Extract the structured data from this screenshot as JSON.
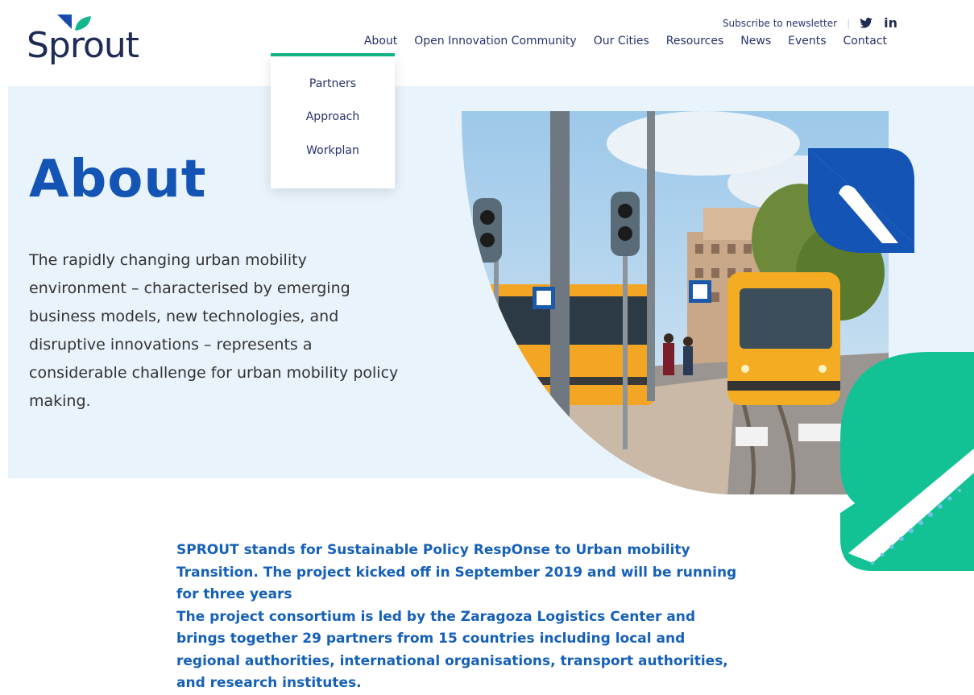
{
  "brand": {
    "name": "Sprout",
    "color_navy": "#1f2b57",
    "color_blue": "#1354b4",
    "color_green": "#12b88a"
  },
  "topbar": {
    "subscribe_label": "Subscribe to newsletter",
    "separator": "|",
    "twitter_icon": "twitter-icon",
    "linkedin_label": "in"
  },
  "nav": {
    "items": [
      "About",
      "Open Innovation Community",
      "Our Cities",
      "Resources",
      "News",
      "Events",
      "Contact"
    ]
  },
  "dropdown": {
    "items": [
      "Partners",
      "Approach",
      "Workplan"
    ]
  },
  "hero": {
    "title": "About",
    "intro": "The rapidly changing urban mobility environment – characterised by emerging business models, new technologies, and disruptive innovations – represents a considerable challenge for urban mobility policy making."
  },
  "body": {
    "paragraph_1": "SPROUT stands for Sustainable Policy RespOnse to Urban mobility Transition. The project kicked off in September 2019 and will be running for three years",
    "paragraph_2": "The project consortium is led by the Zaragoza Logistics Center and brings together 29 partners from 15 countries including local and regional authorities, international organisations, transport authorities, and research institutes."
  }
}
